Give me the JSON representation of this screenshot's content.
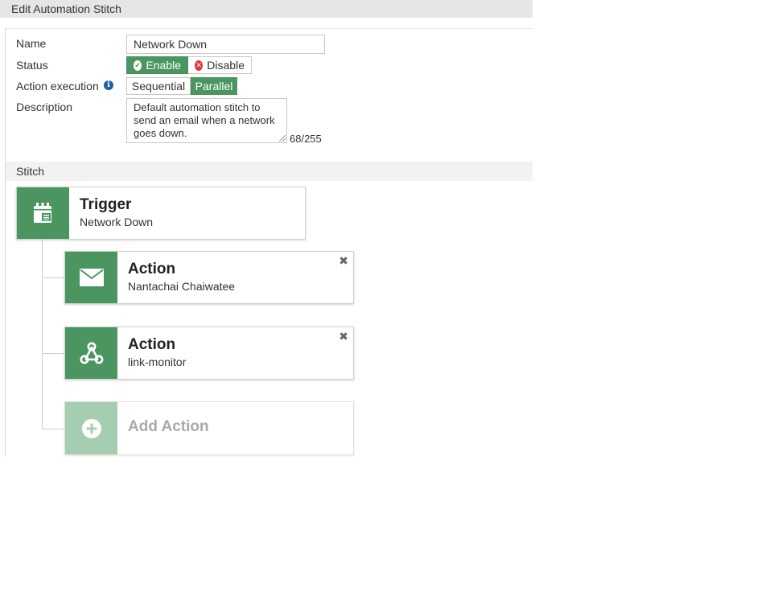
{
  "window": {
    "title": "Edit Automation Stitch"
  },
  "form": {
    "name_label": "Name",
    "name_value": "Network Down",
    "status_label": "Status",
    "status_enable": "Enable",
    "status_disable": "Disable",
    "status_selected": "Enable",
    "action_exec_label": "Action execution",
    "exec_sequential": "Sequential",
    "exec_parallel": "Parallel",
    "exec_selected": "Parallel",
    "description_label": "Description",
    "description_value": "Default automation stitch to send an email when a network goes down.",
    "description_counter": "68/255"
  },
  "stitch": {
    "section_title": "Stitch",
    "trigger": {
      "title": "Trigger",
      "subtitle": "Network Down",
      "icon": "calendar-event-icon"
    },
    "actions": [
      {
        "title": "Action",
        "subtitle": "Nantachai Chaiwatee",
        "icon": "envelope-icon"
      },
      {
        "title": "Action",
        "subtitle": "link-monitor",
        "icon": "webhook-icon"
      }
    ],
    "add_action": {
      "title": "Add Action",
      "icon": "plus-circle-icon"
    }
  },
  "colors": {
    "accent_green": "#4a9560",
    "faded_green": "#a5cdb0",
    "disable_red": "#d9363e",
    "info_blue": "#1d5fa6",
    "titlebar_gray": "#e6e6e6"
  }
}
